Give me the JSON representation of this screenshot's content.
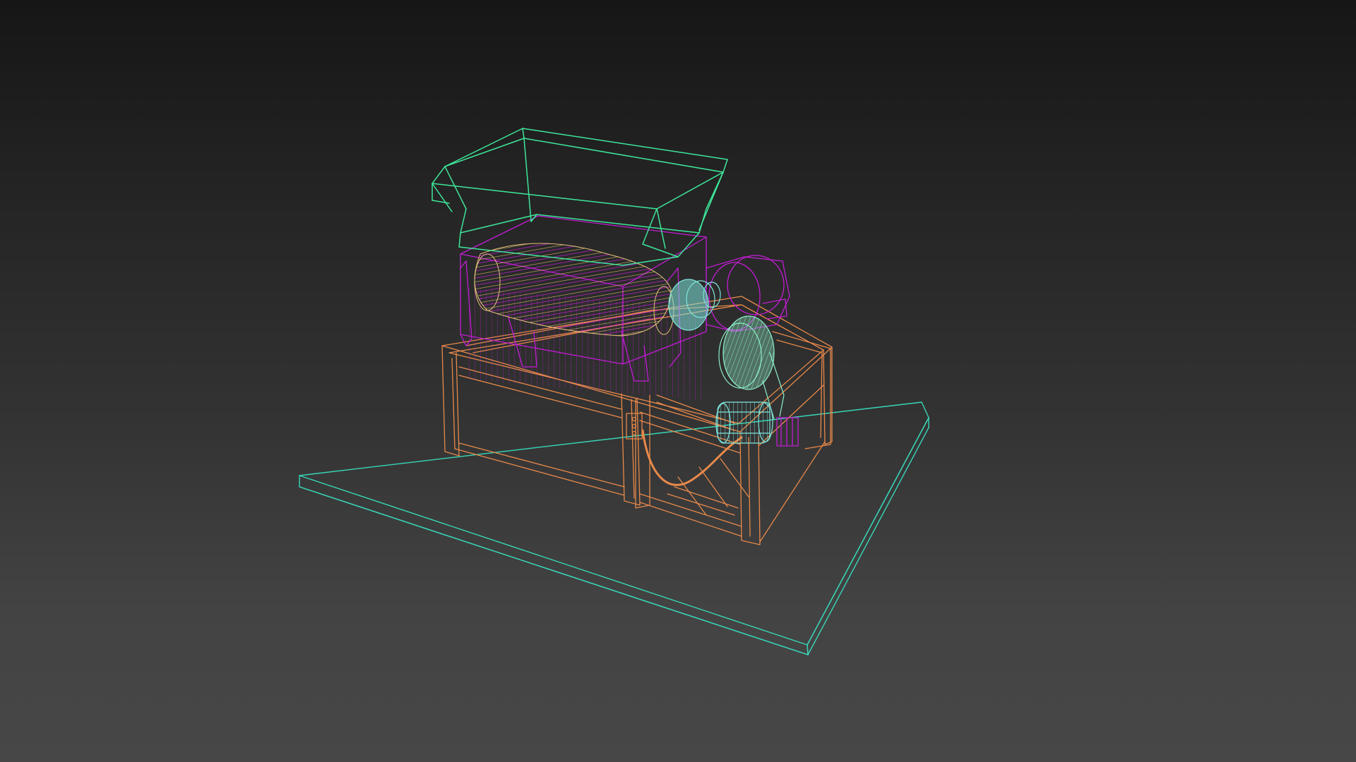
{
  "viewport": {
    "background_top": "#161616",
    "background_bottom": "#474747",
    "render_mode": "wireframe"
  },
  "scene": {
    "objects": [
      {
        "name": "ground-plane",
        "color": "#38d6b8"
      },
      {
        "name": "hopper",
        "color": "#3ee69a"
      },
      {
        "name": "machine-frame",
        "color": "#e8894a"
      },
      {
        "name": "shredder-housing",
        "color": "#c21cd4"
      },
      {
        "name": "blade-shaft",
        "color": "#e6c27a"
      },
      {
        "name": "gear-cap",
        "color": "#7fe6dc"
      },
      {
        "name": "drive-pulley",
        "color": "#8ef0c8"
      },
      {
        "name": "motor",
        "color": "#7fe6dc"
      }
    ]
  }
}
